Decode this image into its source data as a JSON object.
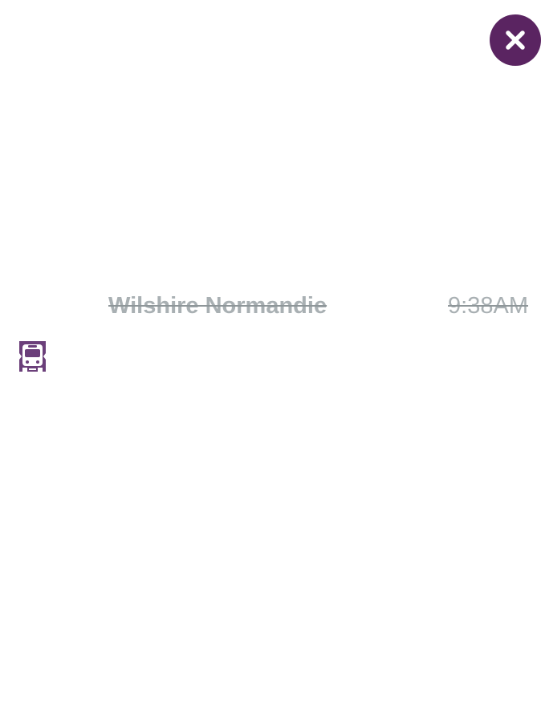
{
  "close_button": {
    "icon": "close-icon",
    "color": "#5a2461"
  },
  "stop": {
    "name": "Wilshire Normandie",
    "time": "9:38AM",
    "status": "passed",
    "mode_icon": "train-icon",
    "mode_icon_color": "#6b3f7a"
  },
  "colors": {
    "muted_text": "#a9b0b3",
    "accent": "#5a2461"
  }
}
